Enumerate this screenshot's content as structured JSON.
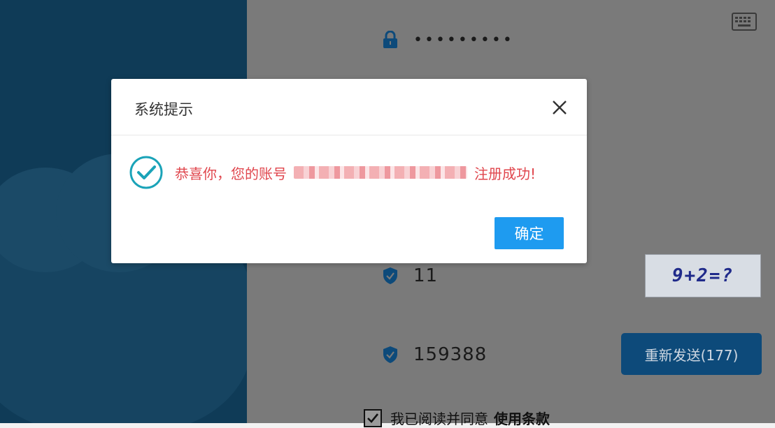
{
  "background_form": {
    "password_mask": "•••••••••",
    "captcha_input": "11",
    "captcha_image_text": "9+2=?",
    "sms_code": "159388",
    "resend_label": "重新发送(177)",
    "agree_text": "我已阅读并同意",
    "terms_link": "使用条款"
  },
  "dialog": {
    "title": "系统提示",
    "message_prefix": "恭喜你，您的账号",
    "message_suffix": "注册成功!",
    "confirm_label": "确定"
  },
  "colors": {
    "left_panel": "#0f3b57",
    "message_red": "#e0464d",
    "confirm_blue": "#1e9bf0",
    "success_teal": "#1aa3b8",
    "resend_bg": "#0d4a7a"
  },
  "icons": [
    "lock-icon",
    "keyboard-icon",
    "shield-icon",
    "close-icon",
    "success-check-icon",
    "checkbox-checked-icon"
  ]
}
